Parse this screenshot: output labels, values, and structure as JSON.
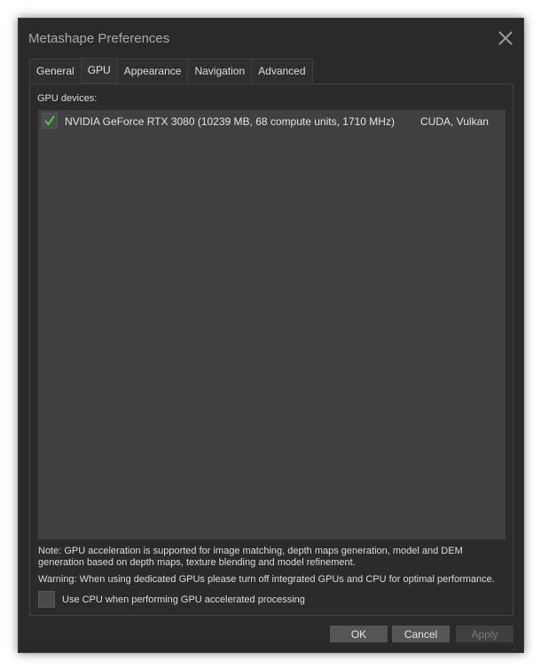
{
  "window": {
    "title": "Metashape Preferences"
  },
  "tabs": [
    {
      "label": "General"
    },
    {
      "label": "GPU"
    },
    {
      "label": "Appearance"
    },
    {
      "label": "Navigation"
    },
    {
      "label": "Advanced"
    }
  ],
  "active_tab": "GPU",
  "gpu": {
    "devices_label": "GPU devices:",
    "devices": [
      {
        "name": "NVIDIA GeForce RTX 3080 (10239 MB, 68 compute units, 1710 MHz)",
        "api": "CUDA, Vulkan",
        "checked": true
      }
    ],
    "note": "Note: GPU acceleration is supported for image matching, depth maps generation, model and DEM generation based on depth maps, texture blending and model refinement.",
    "warning": "Warning: When using dedicated GPUs please turn off integrated GPUs and CPU for optimal performance.",
    "use_cpu_label": "Use CPU when performing GPU accelerated processing",
    "use_cpu_checked": false
  },
  "buttons": {
    "ok": "OK",
    "cancel": "Cancel",
    "apply": "Apply"
  },
  "colors": {
    "check": "#4ec94e",
    "background": "#2a2a2a",
    "list": "#404040"
  }
}
